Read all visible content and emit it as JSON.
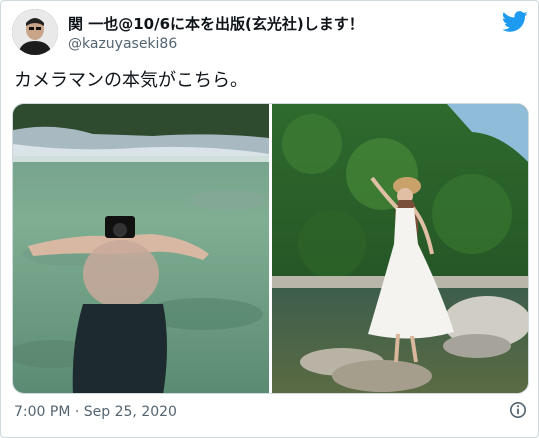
{
  "tweet": {
    "author_name": "関 一也@10/6に本を出版(玄光社)します！",
    "author_handle": "@kazuyaseki86",
    "text": "カメラマンの本気がこちら。",
    "timestamp": "7:00 PM · Sep 25, 2020"
  },
  "icons": {
    "brand": "twitter-bird-icon",
    "info": "info-icon"
  },
  "colors": {
    "twitter_blue": "#1d9bf0",
    "secondary_text": "#536471",
    "border": "#cfd9de"
  }
}
